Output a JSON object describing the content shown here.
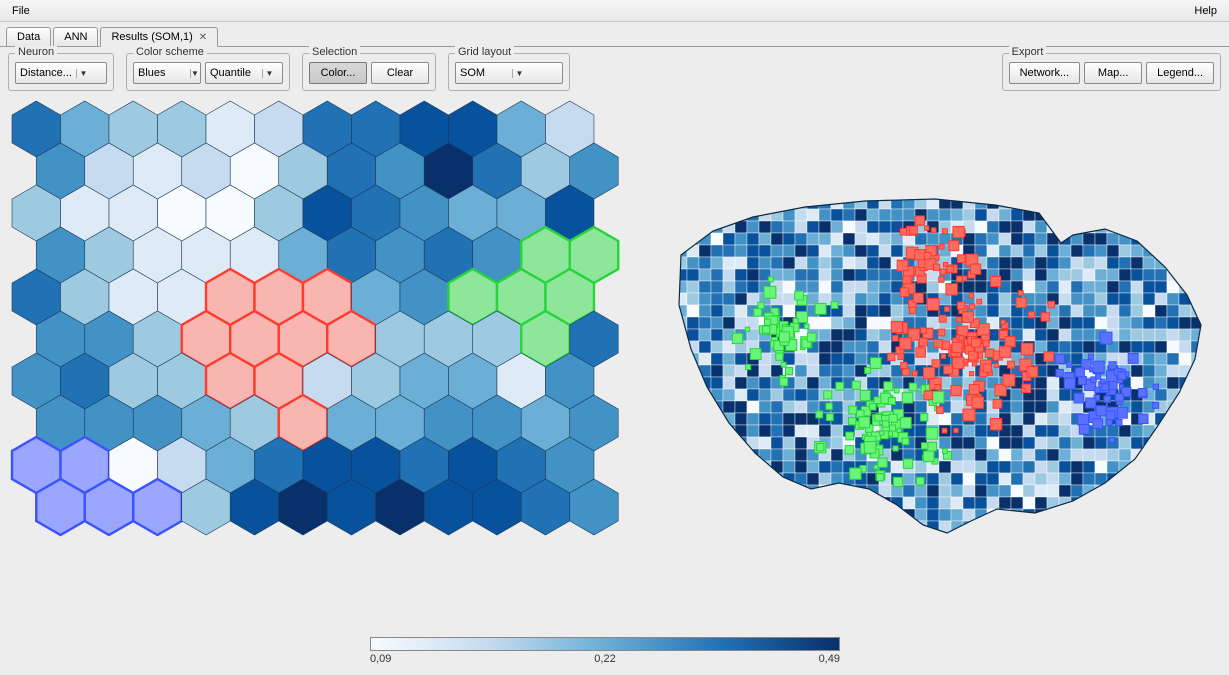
{
  "menubar": {
    "file": "File",
    "help": "Help"
  },
  "tabs": [
    {
      "label": "Data",
      "closable": false
    },
    {
      "label": "ANN",
      "closable": false
    },
    {
      "label": "Results (SOM,1)",
      "closable": true
    }
  ],
  "active_tab": 2,
  "toolbar": {
    "neuron": {
      "legend": "Neuron",
      "value": "Distance..."
    },
    "colorscheme": {
      "legend": "Color scheme",
      "palette": "Blues",
      "method": "Quantile"
    },
    "selection": {
      "legend": "Selection",
      "color": "Color...",
      "clear": "Clear"
    },
    "gridlayout": {
      "legend": "Grid layout",
      "value": "SOM"
    },
    "export": {
      "legend": "Export",
      "network": "Network...",
      "map": "Map...",
      "legend_btn": "Legend..."
    }
  },
  "colorbar": {
    "min": "0,09",
    "mid": "0,22",
    "max": "0,49"
  },
  "hexgrid": {
    "cols": 12,
    "rows": 10,
    "size": 28,
    "palette": [
      "#f7fbff",
      "#deebf7",
      "#c6dbef",
      "#9ecae1",
      "#6baed6",
      "#4292c6",
      "#2171b5",
      "#08519c",
      "#08306b"
    ],
    "levels": [
      [
        6,
        4,
        3,
        3,
        1,
        2,
        6,
        6,
        7,
        7,
        4,
        2
      ],
      [
        5,
        2,
        1,
        2,
        0,
        3,
        6,
        5,
        8,
        6,
        3,
        5
      ],
      [
        3,
        1,
        1,
        0,
        0,
        3,
        7,
        6,
        5,
        4,
        4,
        7
      ],
      [
        5,
        3,
        1,
        1,
        1,
        4,
        6,
        5,
        6,
        5,
        4,
        7
      ],
      [
        6,
        3,
        1,
        1,
        1,
        1,
        3,
        4,
        5,
        3,
        4,
        6
      ],
      [
        5,
        5,
        3,
        2,
        1,
        1,
        1,
        3,
        3,
        3,
        2,
        6
      ],
      [
        5,
        6,
        3,
        3,
        1,
        1,
        2,
        3,
        4,
        4,
        1,
        5
      ],
      [
        5,
        5,
        5,
        4,
        3,
        2,
        4,
        4,
        5,
        5,
        4,
        5
      ],
      [
        4,
        3,
        0,
        2,
        4,
        6,
        7,
        7,
        6,
        7,
        6,
        5
      ],
      [
        4,
        4,
        1,
        3,
        7,
        8,
        7,
        8,
        7,
        7,
        6,
        5
      ]
    ],
    "selections": [
      {
        "color": "#ff3b30",
        "fill": "#f9b5b0",
        "cells": [
          [
            4,
            4
          ],
          [
            4,
            5
          ],
          [
            4,
            6
          ],
          [
            5,
            3
          ],
          [
            5,
            4
          ],
          [
            5,
            5
          ],
          [
            5,
            6
          ],
          [
            6,
            4
          ],
          [
            6,
            5
          ],
          [
            7,
            5
          ]
        ]
      },
      {
        "color": "#27d43a",
        "fill": "#8ee69a",
        "cells": [
          [
            3,
            10
          ],
          [
            3,
            11
          ],
          [
            4,
            9
          ],
          [
            4,
            10
          ],
          [
            4,
            11
          ],
          [
            5,
            10
          ]
        ]
      },
      {
        "color": "#3a53ff",
        "fill": "#9aa6ff",
        "cells": [
          [
            8,
            0
          ],
          [
            8,
            1
          ],
          [
            9,
            0
          ],
          [
            9,
            1
          ],
          [
            9,
            2
          ]
        ]
      }
    ]
  },
  "map": {
    "description": "US choropleth map with county outlines, shaded blue; red, green and blue highlighted county clusters corresponding to hex selections."
  }
}
